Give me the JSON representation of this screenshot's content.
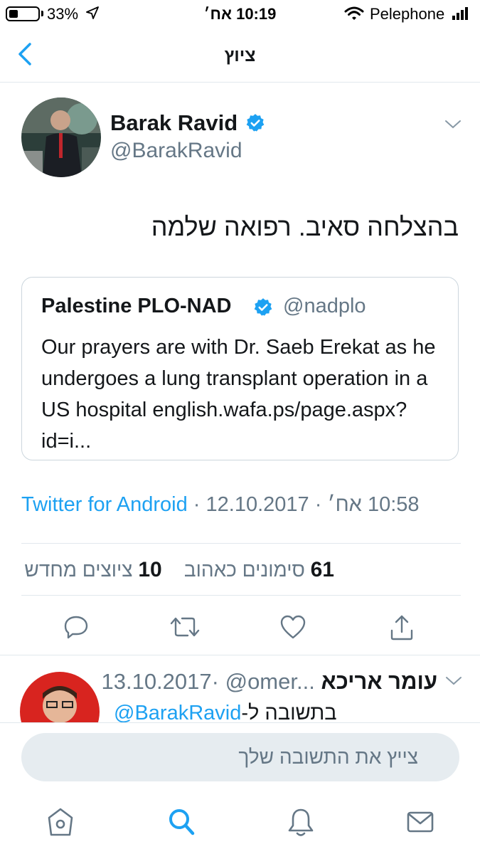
{
  "status_bar": {
    "battery": "33%",
    "time": "10:19 אח׳",
    "carrier": "Pelephone"
  },
  "nav": {
    "title": "ציוץ",
    "back_icon": "chevron-left-icon"
  },
  "tweet": {
    "author_name": "Barak Ravid",
    "author_handle": "@BarakRavid",
    "text": "בהצלחה סאיב. רפואה שלמה",
    "quoted": {
      "name": "Palestine PLO-NAD",
      "handle": "@nadplo",
      "text": "Our prayers are with Dr. Saeb Erekat as he undergoes a lung transplant operation in a US hospital english.wafa.ps/page.aspx?id=i..."
    },
    "source": "Twitter for Android",
    "date": "12.10.2017",
    "time": "10:58 אח׳",
    "likes_count": "61",
    "likes_label": "סימונים כאהוב",
    "retweets_count": "10",
    "retweets_label": "ציוצים מחדש"
  },
  "actions": [
    "reply-icon",
    "retweet-icon",
    "like-icon",
    "share-icon"
  ],
  "reply": {
    "name": "עומר אריכא",
    "handle": "@omer...",
    "date": "13.10.2017",
    "prefix": "בתשובה ל-",
    "mention": "@BarakRavid"
  },
  "composer": {
    "placeholder": "צייץ את התשובה שלך"
  },
  "tab_bar": [
    "home-icon",
    "search-icon",
    "notifications-icon",
    "messages-icon"
  ],
  "colors": {
    "accent": "#1da1f2",
    "secondary_text": "#657786",
    "divider": "#e1e8ed"
  }
}
